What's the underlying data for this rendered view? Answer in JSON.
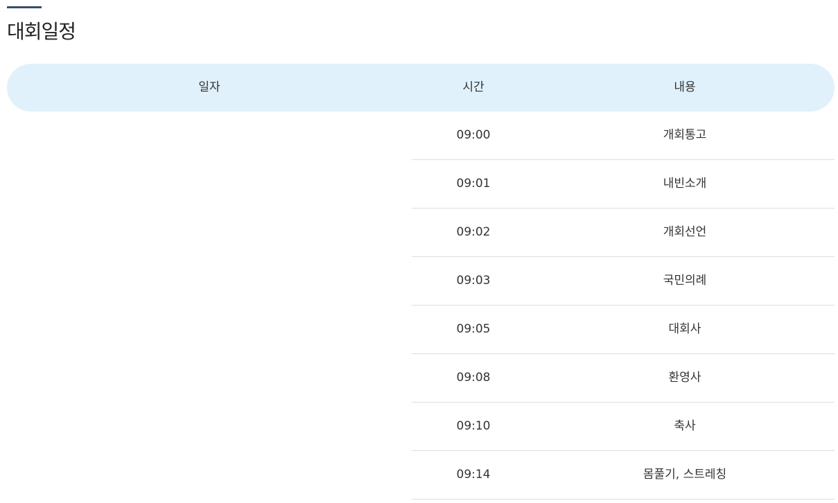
{
  "page": {
    "title": "대회일정"
  },
  "table": {
    "headers": {
      "date": "일자",
      "time": "시간",
      "content": "내용"
    },
    "rows": [
      {
        "time": "09:00",
        "content": "개회통고"
      },
      {
        "time": "09:01",
        "content": "내빈소개"
      },
      {
        "time": "09:02",
        "content": "개회선언"
      },
      {
        "time": "09:03",
        "content": "국민의례"
      },
      {
        "time": "09:05",
        "content": "대회사"
      },
      {
        "time": "09:08",
        "content": "환영사"
      },
      {
        "time": "09:10",
        "content": "축사"
      },
      {
        "time": "09:14",
        "content": "몸풀기, 스트레칭"
      }
    ]
  }
}
